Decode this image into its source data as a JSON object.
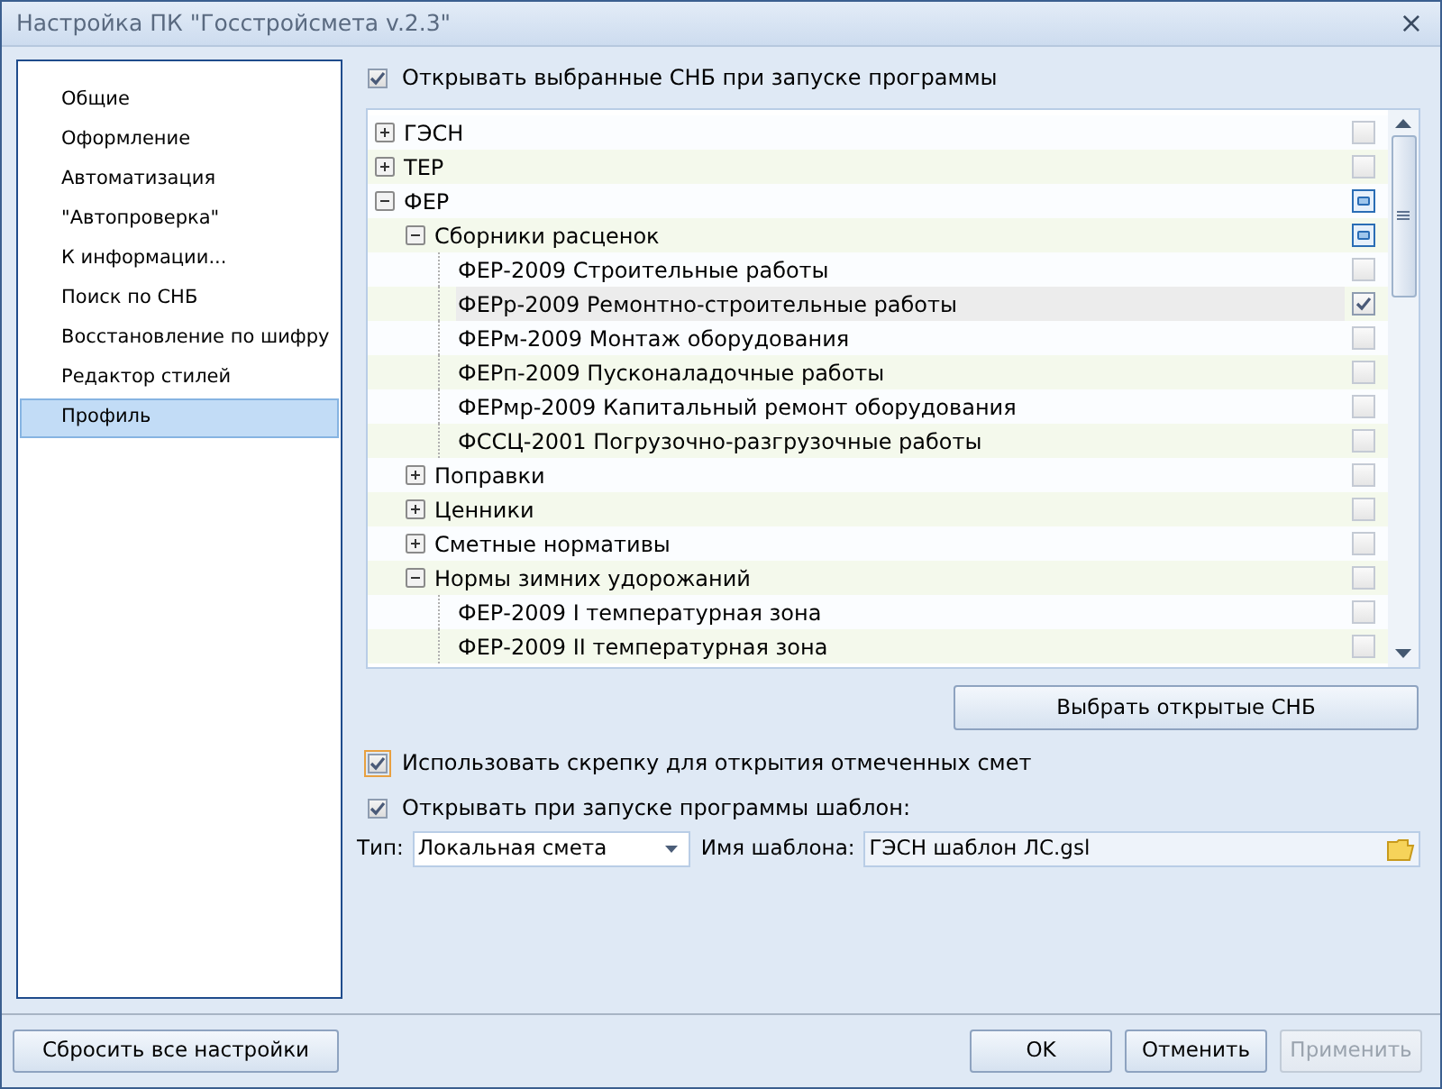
{
  "window": {
    "title": "Настройка ПК \"Госстройсмета v.2.3\"",
    "close": "×"
  },
  "sidebar": {
    "items": [
      {
        "label": "Общие",
        "selected": false
      },
      {
        "label": "Оформление",
        "selected": false
      },
      {
        "label": "Автоматизация",
        "selected": false
      },
      {
        "label": "\"Автопроверка\"",
        "selected": false
      },
      {
        "label": "К информации...",
        "selected": false
      },
      {
        "label": "Поиск по СНБ",
        "selected": false
      },
      {
        "label": "Восстановление по шифру",
        "selected": false
      },
      {
        "label": "Редактор стилей",
        "selected": false
      },
      {
        "label": "Профиль",
        "selected": true
      }
    ]
  },
  "open_selected": {
    "label": "Открывать выбранные СНБ при запуске программы",
    "checked": true
  },
  "tree": [
    {
      "label": "ГЭСН",
      "expanded": false,
      "checked": false,
      "selected": false
    },
    {
      "label": "ТЕР",
      "expanded": false,
      "checked": false,
      "selected": false
    },
    {
      "label": "ФЕР",
      "expanded": true,
      "partial": true,
      "selected": false,
      "children": [
        {
          "label": "Сборники расценок",
          "expanded": true,
          "partial": true,
          "selected": false,
          "children": [
            {
              "label": "ФЕР-2009 Строительные работы",
              "checked": false,
              "selected": false
            },
            {
              "label": "ФЕРр-2009 Ремонтно-строительные работы",
              "checked": true,
              "selected": true
            },
            {
              "label": "ФЕРм-2009 Монтаж оборудования",
              "checked": false,
              "selected": false
            },
            {
              "label": "ФЕРп-2009 Пусконаладочные работы",
              "checked": false,
              "selected": false
            },
            {
              "label": "ФЕРмр-2009 Капитальный ремонт оборудования",
              "checked": false,
              "selected": false
            },
            {
              "label": "ФССЦ-2001 Погрузочно-разгрузочные работы",
              "checked": false,
              "selected": false
            }
          ]
        },
        {
          "label": "Поправки",
          "expanded": false,
          "checked": false,
          "selected": false
        },
        {
          "label": "Ценники",
          "expanded": false,
          "checked": false,
          "selected": false
        },
        {
          "label": "Сметные нормативы",
          "expanded": false,
          "checked": false,
          "selected": false
        },
        {
          "label": "Нормы зимних удорожаний",
          "expanded": true,
          "checked": false,
          "selected": false,
          "children": [
            {
              "label": "ФЕР-2009 I температурная зона",
              "checked": false,
              "selected": false
            },
            {
              "label": "ФЕР-2009 II температурная зона",
              "checked": false,
              "selected": false
            }
          ]
        }
      ]
    }
  ],
  "choose_button": "Выбрать открытые СНБ",
  "use_clip": {
    "label": "Использовать скрепку для открытия отмеченных смет",
    "checked": true,
    "focused": true
  },
  "open_template": {
    "label": "Открывать при запуске программы шаблон:",
    "checked": true
  },
  "type_label": "Тип:",
  "type_value": "Локальная смета",
  "template_label": "Имя шаблона:",
  "template_value": "ГЭСН шаблон ЛС.gsl",
  "reset_button": "Сбросить все настройки",
  "buttons": [
    {
      "label": "OK",
      "disabled": false
    },
    {
      "label": "Отменить",
      "disabled": false
    },
    {
      "label": "Применить",
      "disabled": true
    }
  ]
}
